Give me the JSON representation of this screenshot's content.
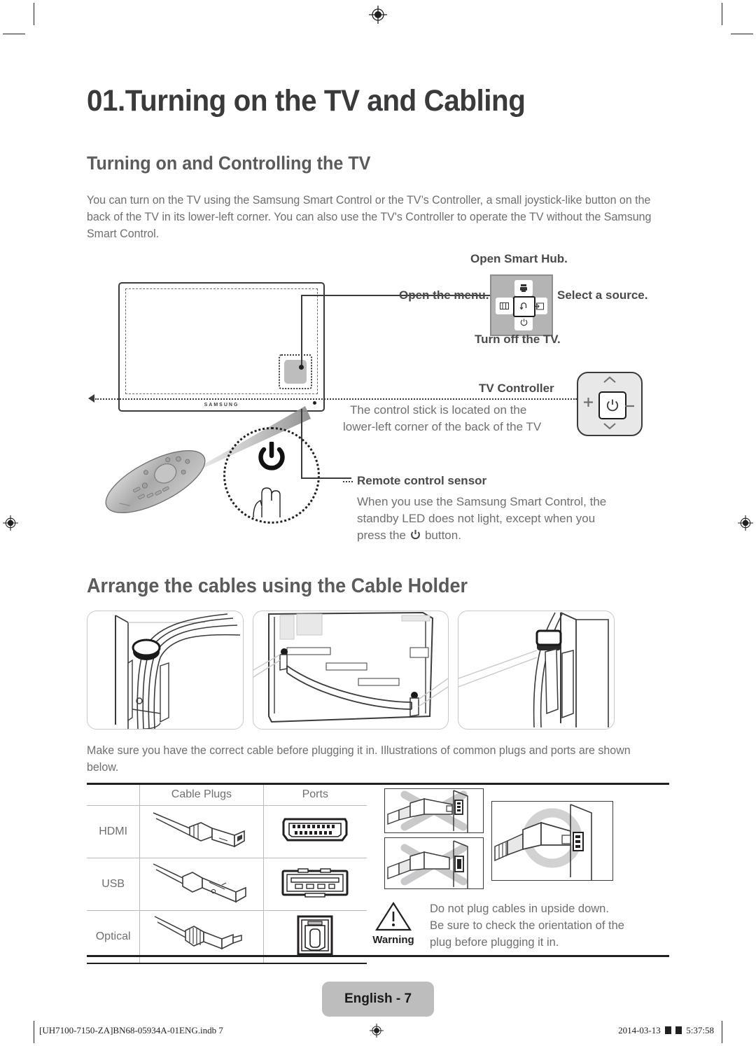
{
  "document": {
    "chapter_title": "01.Turning on the TV and Cabling",
    "page_label": "English - 7",
    "footer_file": "[UH7100-7150-ZA]BN68-05934A-01ENG.indb   7",
    "footer_date": "2014-03-13",
    "footer_time": "5:37:58"
  },
  "section1": {
    "heading": "Turning on and Controlling the TV",
    "paragraph": "You can turn on the TV using the Samsung Smart Control or the TV’s Controller, a small joystick-like button on the back of the TV in its lower-left corner. You can also use the TV's Controller to operate the TV without the Samsung Smart Control.",
    "callouts": {
      "smart_hub": "Open Smart Hub.",
      "menu": "Open the menu.",
      "source": "Select a source.",
      "power_off": "Turn off the TV."
    },
    "controller": {
      "title": "TV Controller",
      "line1": "The control stick is located on the",
      "line2": "lower-left corner of the back of the TV"
    },
    "sensor": {
      "title": "Remote control sensor",
      "line1": "When you use the Samsung Smart Control, the",
      "line2": "standby LED does not light, except when you",
      "line3_before": "press the",
      "line3_after": "button."
    },
    "tv_brand": "SAMSUNG"
  },
  "section2": {
    "heading": "Arrange the cables using the Cable Holder",
    "paragraph": "Make sure you have the correct cable before plugging it in. Illustrations of common plugs and ports are shown below."
  },
  "table": {
    "headers": [
      "",
      "Cable Plugs",
      "Ports"
    ],
    "rows": [
      {
        "label": "HDMI",
        "plug_icon": "hdmi-plug-icon",
        "port_icon": "hdmi-port-icon"
      },
      {
        "label": "USB",
        "plug_icon": "usb-plug-icon",
        "port_icon": "usb-port-icon"
      },
      {
        "label": "Optical",
        "plug_icon": "optical-plug-icon",
        "port_icon": "optical-port-icon"
      }
    ]
  },
  "warning": {
    "label": "Warning",
    "line1": "Do not plug cables in upside down.",
    "line2": "Be sure to check the orientation of the",
    "line3": "plug before plugging it in."
  },
  "icons": {
    "smart_hub": "smart-hub-icon",
    "menu": "menu-icon",
    "return": "return-icon",
    "source": "source-icon",
    "power": "power-icon",
    "chevron_up": "chevron-up-icon",
    "chevron_down": "chevron-down-icon",
    "plus": "plus-icon",
    "minus": "minus-icon",
    "warning_triangle": "warning-triangle-icon",
    "registration_mark": "registration-mark-icon"
  },
  "colors": {
    "heading": "#3a3a3c",
    "subheading": "#5b5b5e",
    "body": "#6f6f72",
    "rule": "#231f20",
    "badge": "#bdbdbd",
    "dpad": "#b4b4b4"
  }
}
